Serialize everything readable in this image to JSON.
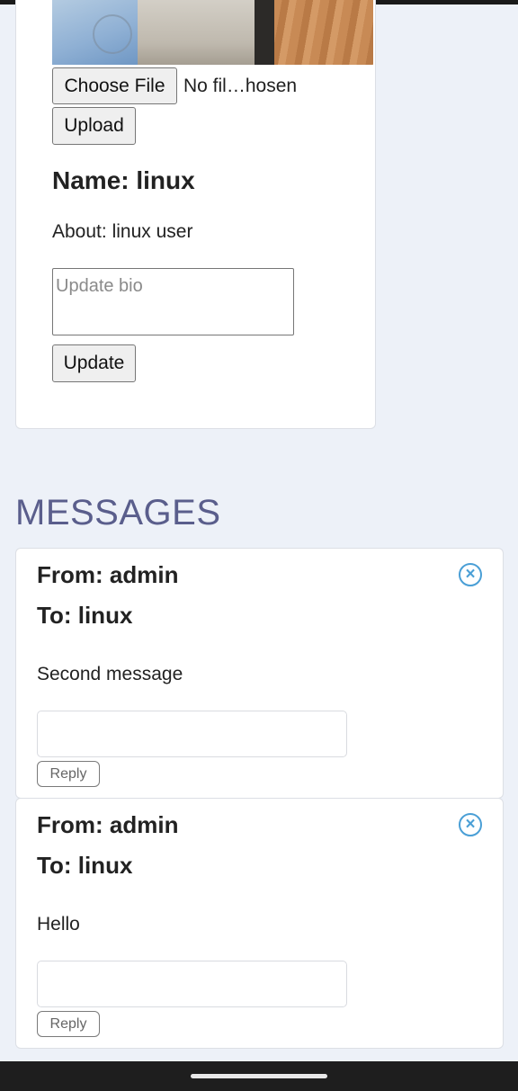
{
  "profile": {
    "file_button_label": "Choose File",
    "file_status": "No fil…hosen",
    "upload_label": "Upload",
    "name_label": "Name:",
    "name_value": "linux",
    "about_label": "About:",
    "about_value": "linux user",
    "bio_placeholder": "Update bio",
    "update_label": "Update"
  },
  "messages": {
    "heading": "MESSAGES",
    "items": [
      {
        "from_label": "From:",
        "from": "admin",
        "to_label": "To:",
        "to": "linux",
        "body": "Second message",
        "reply_label": "Reply",
        "close_icon": "close-circle-icon"
      },
      {
        "from_label": "From:",
        "from": "admin",
        "to_label": "To:",
        "to": "linux",
        "body": "Hello",
        "reply_label": "Reply",
        "close_icon": "close-circle-icon"
      }
    ]
  },
  "colors": {
    "page_background": "#edf1f8",
    "heading": "#5a5e8c",
    "close_icon": "#4a9fd6"
  }
}
